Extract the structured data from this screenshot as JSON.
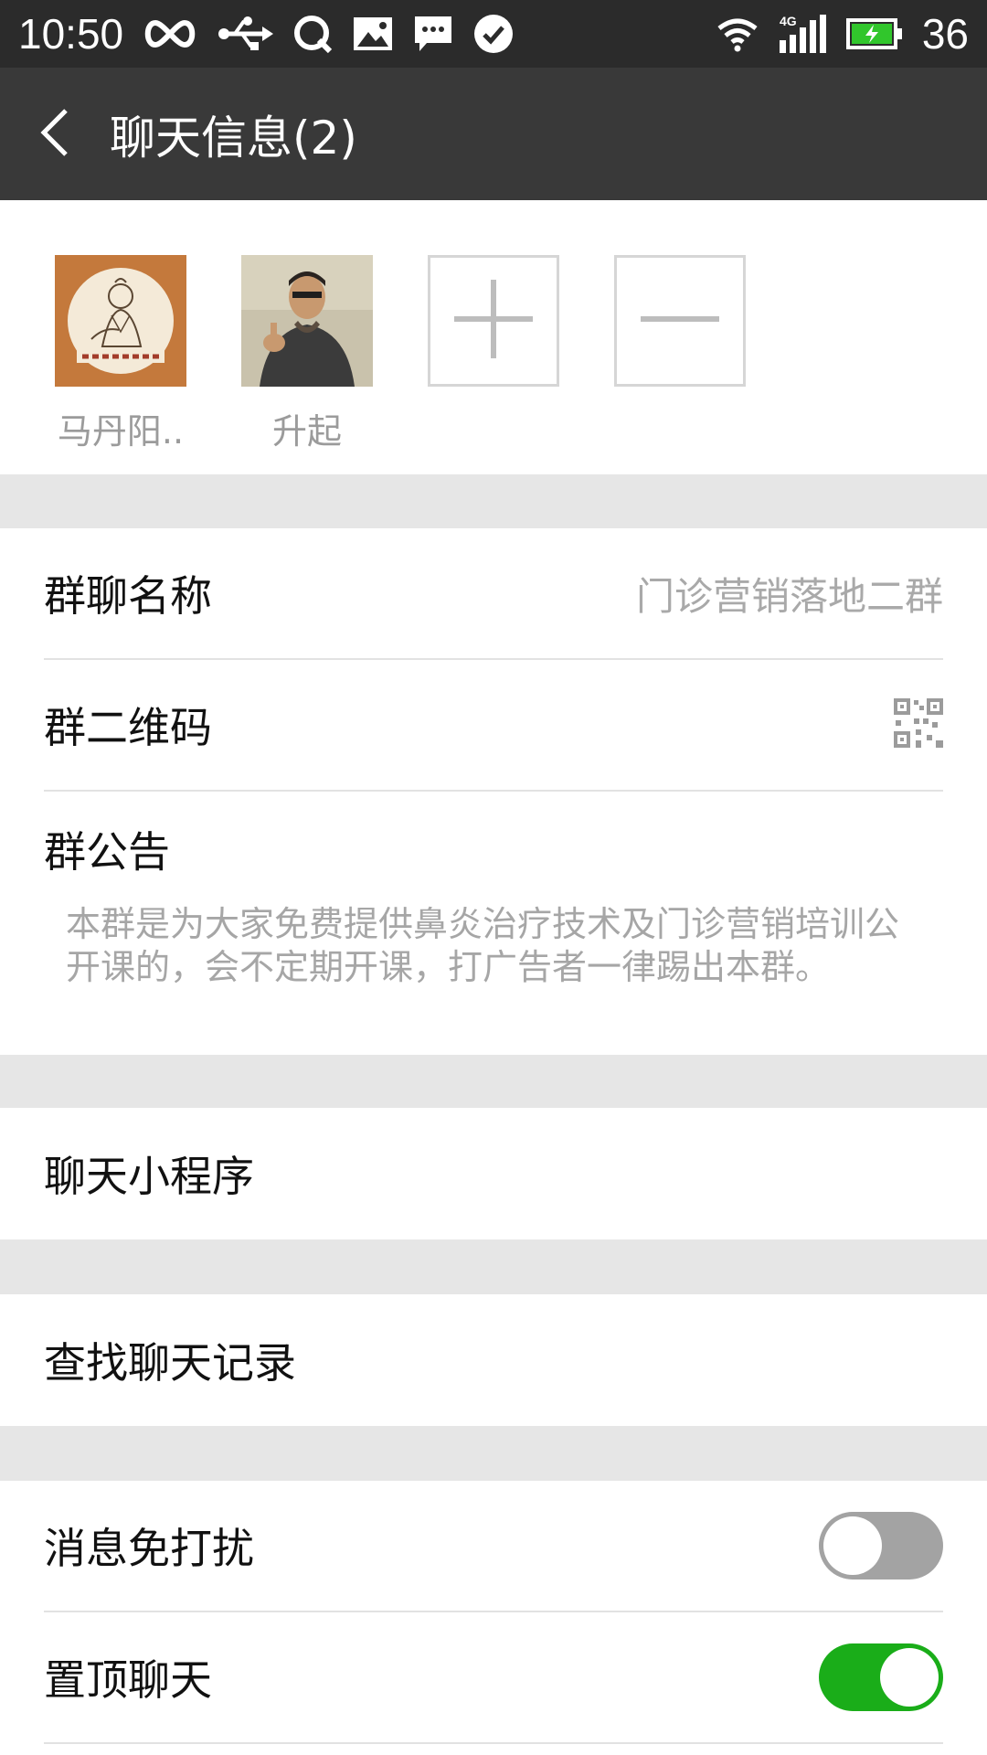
{
  "status_bar": {
    "time": "10:50",
    "battery_level": "36",
    "icons": [
      "infinity-icon",
      "usb-icon",
      "qq-icon",
      "image-icon",
      "message-icon",
      "check-circle-icon",
      "wifi-icon",
      "signal-4g-icon",
      "battery-charging-icon"
    ]
  },
  "header": {
    "title": "聊天信息(2)",
    "back_icon": "back-arrow-icon"
  },
  "members": [
    {
      "name": "马丹阳.."
    },
    {
      "name": "升起"
    }
  ],
  "member_actions": {
    "add_icon": "plus-icon",
    "remove_icon": "minus-icon"
  },
  "group_info": {
    "name_label": "群聊名称",
    "name_value": "门诊营销落地二群",
    "qr_label": "群二维码",
    "notice_label": "群公告",
    "notice_text": "本群是为大家免费提供鼻炎治疗技术及门诊营销培训公开课的，会不定期开课，打广告者一律踢出本群。"
  },
  "mini_programs": {
    "label": "聊天小程序"
  },
  "search": {
    "label": "查找聊天记录"
  },
  "settings": {
    "mute_label": "消息免打扰",
    "mute_on": false,
    "pin_label": "置顶聊天",
    "pin_on": true
  },
  "colors": {
    "toggle_on": "#1aad19",
    "toggle_off": "#a3a3a3",
    "header_bg": "#393939",
    "statusbar_bg": "#2b2b2b"
  }
}
